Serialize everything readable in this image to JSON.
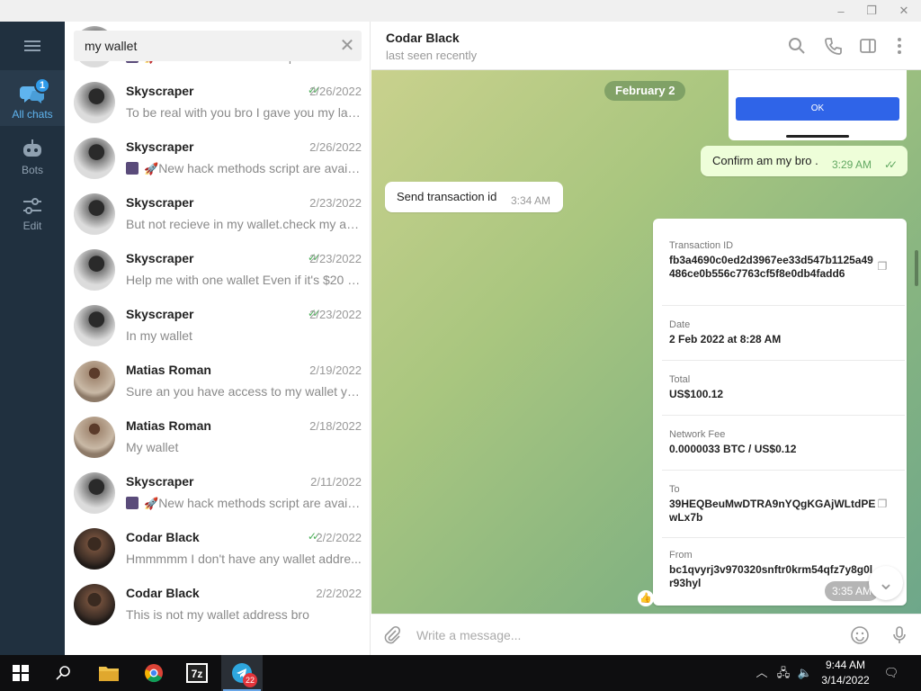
{
  "window": {
    "minimize": "–",
    "restore": "❐",
    "close": "✕"
  },
  "rail": {
    "items": [
      {
        "label": "All chats",
        "badge": "1"
      },
      {
        "label": "Bots"
      },
      {
        "label": "Edit"
      }
    ]
  },
  "search": {
    "value": "my wallet",
    "clear_icon": "close-icon"
  },
  "chats": [
    {
      "name": "",
      "date": "",
      "preview": "New hack methods script are availa...",
      "avatar": "sky",
      "check": false,
      "mini": true
    },
    {
      "name": "Skyscraper",
      "date": "2/26/2022",
      "preview": "To be real with you bro   I gave you my las...",
      "avatar": "sky",
      "check": true,
      "mini": false
    },
    {
      "name": "Skyscraper",
      "date": "2/26/2022",
      "preview": "New hack methods script are availa...",
      "avatar": "sky",
      "check": false,
      "mini": true
    },
    {
      "name": "Skyscraper",
      "date": "2/23/2022",
      "preview": "But not recieve in my wallet.check my add...",
      "avatar": "sky",
      "check": false,
      "mini": false
    },
    {
      "name": "Skyscraper",
      "date": "2/23/2022",
      "preview": "Help me with one wallet   Even if it's $20 I ...",
      "avatar": "sky",
      "check": true,
      "mini": false
    },
    {
      "name": "Skyscraper",
      "date": "2/23/2022",
      "preview": "In my wallet",
      "avatar": "sky",
      "check": true,
      "mini": false
    },
    {
      "name": "Matias Roman",
      "date": "2/19/2022",
      "preview": "Sure an you have access to my wallet you ...",
      "avatar": "mat",
      "check": false,
      "mini": false
    },
    {
      "name": "Matias Roman",
      "date": "2/18/2022",
      "preview": "My wallet",
      "avatar": "mat",
      "check": false,
      "mini": false
    },
    {
      "name": "Skyscraper",
      "date": "2/11/2022",
      "preview": "New hack methods script are availa...",
      "avatar": "sky",
      "check": false,
      "mini": true
    },
    {
      "name": "Codar Black",
      "date": "2/2/2022",
      "preview": "Hmmmmm   I don't have any wallet addre...",
      "avatar": "cod",
      "check": true,
      "mini": false
    },
    {
      "name": "Codar Black",
      "date": "2/2/2022",
      "preview": "This is not my wallet address bro",
      "avatar": "cod",
      "check": false,
      "mini": false
    }
  ],
  "header": {
    "title": "Codar Black",
    "status": "last seen recently"
  },
  "messages": {
    "date_pill": "February 2",
    "ok_label": "OK",
    "out1": {
      "text": "Confirm am my bro .",
      "time": "3:29 AM"
    },
    "in1": {
      "text": "Send transaction id",
      "time": "3:34 AM"
    },
    "card_time": "3:35 AM"
  },
  "transaction": {
    "id_label": "Transaction ID",
    "id_value": "fb3a4690c0ed2d3967ee33d547b1125a49486ce0b556c7763cf5f8e0db4fadd6",
    "date_label": "Date",
    "date_value": "2 Feb 2022 at 8:28 AM",
    "total_label": "Total",
    "total_value": "US$100.12",
    "fee_label": "Network Fee",
    "fee_value": "0.0000033 BTC / US$0.12",
    "to_label": "To",
    "to_value": "39HEQBeuMwDTRA9nYQgKGAjWLtdPEwLx7b",
    "from_label": "From",
    "from_value": "bc1qvyrj3v970320snftr0krm54qfz7y8g0lr93hyl"
  },
  "composer": {
    "placeholder": "Write a message..."
  },
  "taskbar": {
    "telegram_badge": "22",
    "time": "9:44 AM",
    "date": "3/14/2022"
  },
  "colors": {
    "rail_bg": "#20303f",
    "accent": "#2f9bea",
    "out_bubble": "#eefed9",
    "check_green": "#4fb05b"
  }
}
